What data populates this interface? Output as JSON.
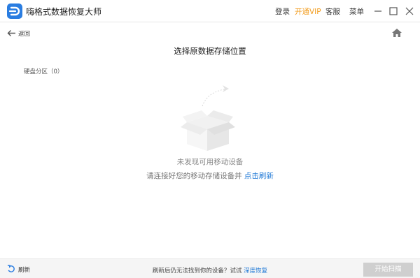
{
  "app": {
    "title": "嗨格式数据恢复大师",
    "logo_icon": "app-logo-icon",
    "accent_color": "#2a7de1"
  },
  "topbar": {
    "login": "登录",
    "vip": "开通VIP",
    "vip_color": "#f29b1b",
    "service": "客服",
    "menu": "菜单",
    "minimize_icon": "minimize-icon",
    "maximize_icon": "maximize-icon",
    "close_icon": "close-icon"
  },
  "subheader": {
    "back_label": "返回",
    "back_icon": "arrow-left-icon",
    "home_icon": "home-icon"
  },
  "main": {
    "title": "选择原数据存储位置",
    "disk_section_label": "硬盘分区（0）",
    "empty_title": "未发现可用移动设备",
    "empty_sub_prefix": "请连接好您的移动存储设备并",
    "empty_sub_link": "点击刷新",
    "illustration_icon": "empty-box-icon",
    "link_color": "#1e78d6"
  },
  "bottombar": {
    "refresh_label": "刷新",
    "refresh_icon": "refresh-icon",
    "hint_prefix": "刷新后仍无法找到你的设备？试试",
    "hint_link": "深度恢复",
    "start_button": "开始扫描",
    "start_button_enabled": false
  }
}
